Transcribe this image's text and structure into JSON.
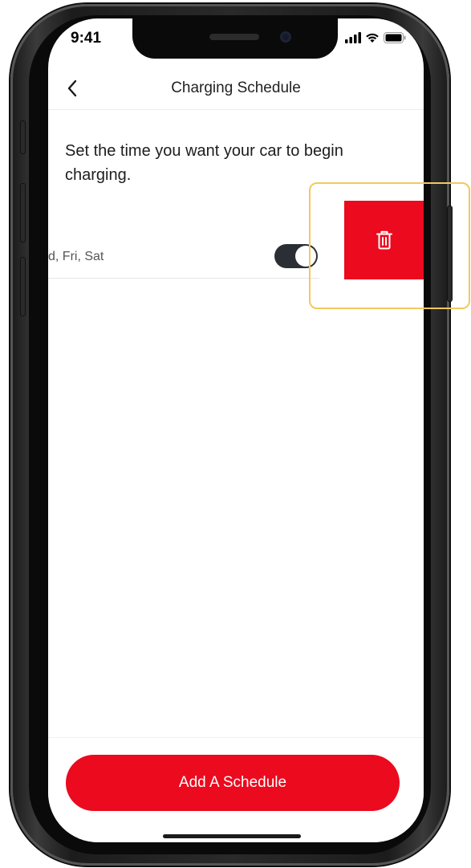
{
  "status_bar": {
    "time": "9:41"
  },
  "nav": {
    "title": "Charging Schedule",
    "back_icon": "chevron-left-icon"
  },
  "instructions": "Set the time you want your car to begin charging.",
  "schedule": {
    "days_text": "d, Fri, Sat",
    "enabled": true,
    "delete_icon": "trash-icon"
  },
  "add_button": {
    "label": "Add A Schedule"
  },
  "colors": {
    "accent": "#eb0a1e",
    "toggle_on": "#2b2f35",
    "text": "#1d1d1d",
    "highlight": "#f3c85e"
  }
}
